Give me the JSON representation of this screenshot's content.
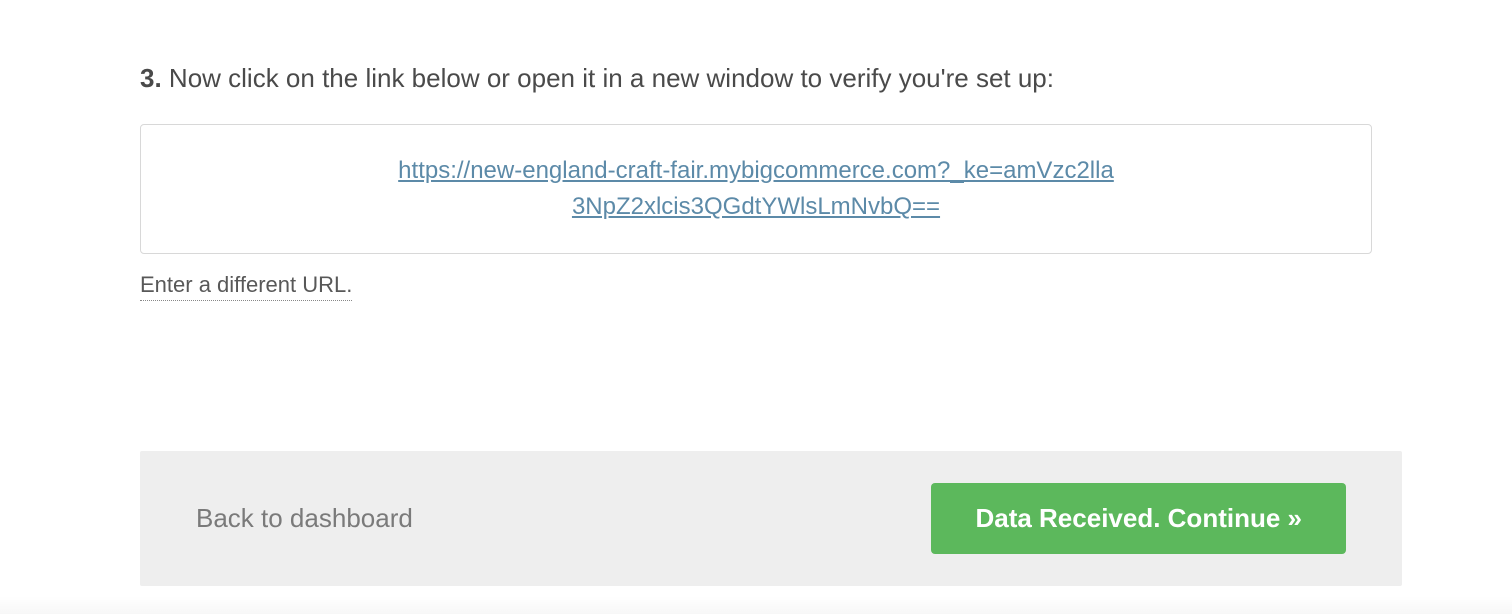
{
  "step": {
    "number": "3.",
    "text": "Now click on the link below or open it in a new window to verify you're set up:"
  },
  "verify_url": "https://new-england-craft-fair.mybigcommerce.com?_ke=amVzc2lla3NpZ2xlcis3QGdtYWlsLmNvbQ==",
  "alt_url_label": "Enter a different URL.",
  "footer": {
    "back_label": "Back to dashboard",
    "continue_label": "Data Received. Continue »"
  }
}
